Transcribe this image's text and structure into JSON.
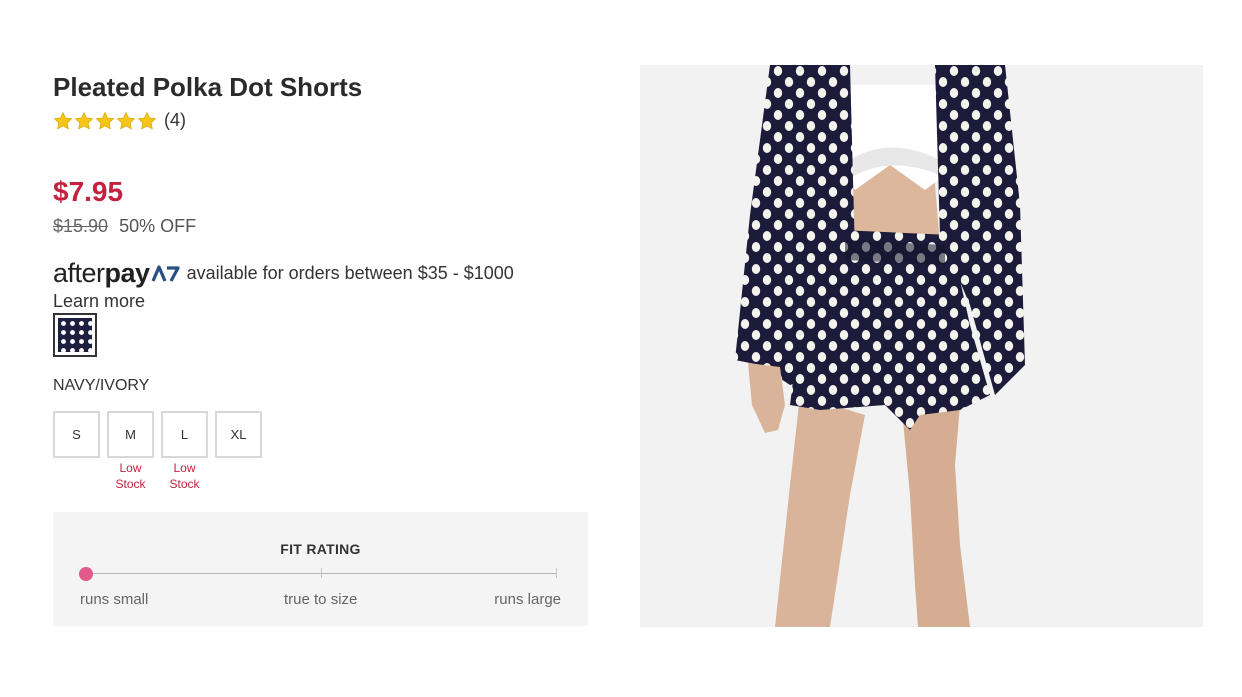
{
  "product": {
    "title": "Pleated Polka Dot Shorts",
    "rating_stars": 5,
    "rating_count": "(4)",
    "price": "$7.95",
    "original_price": "$15.90",
    "discount": "50% OFF"
  },
  "afterpay": {
    "logo_light": "after",
    "logo_bold": "pay",
    "text": "available for orders between $35 - $1000",
    "learn_more": "Learn more"
  },
  "color": {
    "name": "NAVY/IVORY"
  },
  "sizes": [
    {
      "label": "S",
      "stock": ""
    },
    {
      "label": "M",
      "stock_line1": "Low",
      "stock_line2": "Stock"
    },
    {
      "label": "L",
      "stock_line1": "Low",
      "stock_line2": "Stock"
    },
    {
      "label": "XL",
      "stock": ""
    }
  ],
  "fit_rating": {
    "title": "FIT RATING",
    "min_label": "runs small",
    "mid_label": "true to size",
    "max_label": "runs large",
    "value_fraction": 0
  },
  "colors": {
    "price": "#c4213f",
    "low_stock": "#c4213f",
    "fit_dot": "#e05a8a",
    "star": "#f5c518",
    "navy": "#1e1e40"
  },
  "icons": {
    "star": "star-icon",
    "afterpay": "afterpay-logo-icon"
  }
}
